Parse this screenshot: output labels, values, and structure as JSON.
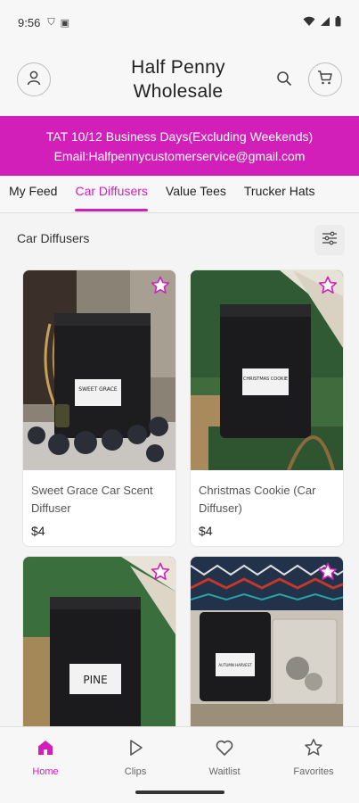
{
  "status_bar": {
    "time": "9:56"
  },
  "header": {
    "title_line1": "Half Penny",
    "title_line2": "Wholesale"
  },
  "banner": {
    "line1": "TAT 10/12 Business Days(Excluding Weekends)",
    "line2": "Email:Halfpennycustomerservice@gmail.com",
    "color": "#d21fb9"
  },
  "tabs": [
    {
      "label": "My Feed",
      "active": false
    },
    {
      "label": "Car Diffusers",
      "active": true
    },
    {
      "label": "Value Tees",
      "active": false
    },
    {
      "label": "Trucker Hats",
      "active": false
    }
  ],
  "section": {
    "title": "Car Diffusers"
  },
  "products": [
    {
      "name": "Sweet Grace Car Scent Diffuser",
      "price": "$4",
      "bag_label": "SWEET GRACE"
    },
    {
      "name": "Christmas Cookie (Car Diffuser)",
      "price": "$4",
      "bag_label": "CHRISTMAS COOKIE"
    },
    {
      "name": "",
      "price": "",
      "bag_label": "PINE"
    },
    {
      "name": "",
      "price": "",
      "bag_label": "AUTUMN HARVEST"
    }
  ],
  "bottom_nav": [
    {
      "label": "Home",
      "icon": "home-icon",
      "active": true
    },
    {
      "label": "Clips",
      "icon": "play-icon",
      "active": false
    },
    {
      "label": "Waitlist",
      "icon": "heart-icon",
      "active": false
    },
    {
      "label": "Favorites",
      "icon": "star-icon",
      "active": false
    }
  ]
}
